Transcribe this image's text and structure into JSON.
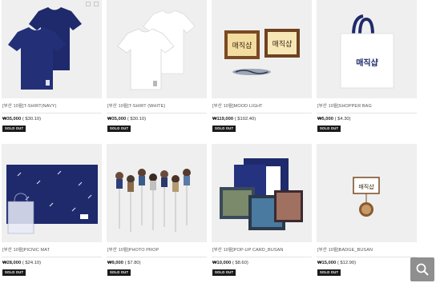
{
  "products": [
    {
      "title": "[부산 10월]T-SHIRT(NAVY)",
      "price": "₩35,000",
      "price_usd": "( $30.10)",
      "badge": "SOLD OUT",
      "image": "navy-tshirt"
    },
    {
      "title": "[부산 10월]T-SHIRT (WHITE)",
      "price": "₩35,000",
      "price_usd": "( $30.10)",
      "badge": "SOLD OUT",
      "image": "white-tshirt"
    },
    {
      "title": "[부산 10월]MOOD LIGHT",
      "price": "₩119,000",
      "price_usd": "( $102.40)",
      "badge": "SOLD OUT",
      "image": "mood-light"
    },
    {
      "title": "[부산 10월]SHOPPER BAG",
      "price": "₩5,000",
      "price_usd": "( $4.30)",
      "badge": "SOLD OUT",
      "image": "shopper-bag"
    },
    {
      "title": "[부산 10월]PICNIC MAT",
      "price": "₩28,000",
      "price_usd": "( $24.10)",
      "badge": "SOLD OUT",
      "image": "picnic-mat"
    },
    {
      "title": "[부산 10월]PHOTO PROP",
      "price": "₩9,000",
      "price_usd": "( $7.80)",
      "badge": "SOLD OUT",
      "image": "photo-prop"
    },
    {
      "title": "[부산 10월]POP-UP CARD_BUSAN",
      "price": "₩10,000",
      "price_usd": "( $8.60)",
      "badge": "SOLD OUT",
      "image": "popup-card"
    },
    {
      "title": "[부산 10월]BADGE_BUSAN",
      "price": "₩15,000",
      "price_usd": "( $12.90)",
      "badge": "SOLD OUT",
      "image": "badge"
    }
  ],
  "sign_text": "매직샵",
  "zoom_icon": "magnifier-icon",
  "colors": {
    "navy": "#1e2a6b",
    "thumb_bg": "#efefef",
    "badge_bg": "#1a1a1a",
    "zoom_bg": "#8f8f8f"
  }
}
